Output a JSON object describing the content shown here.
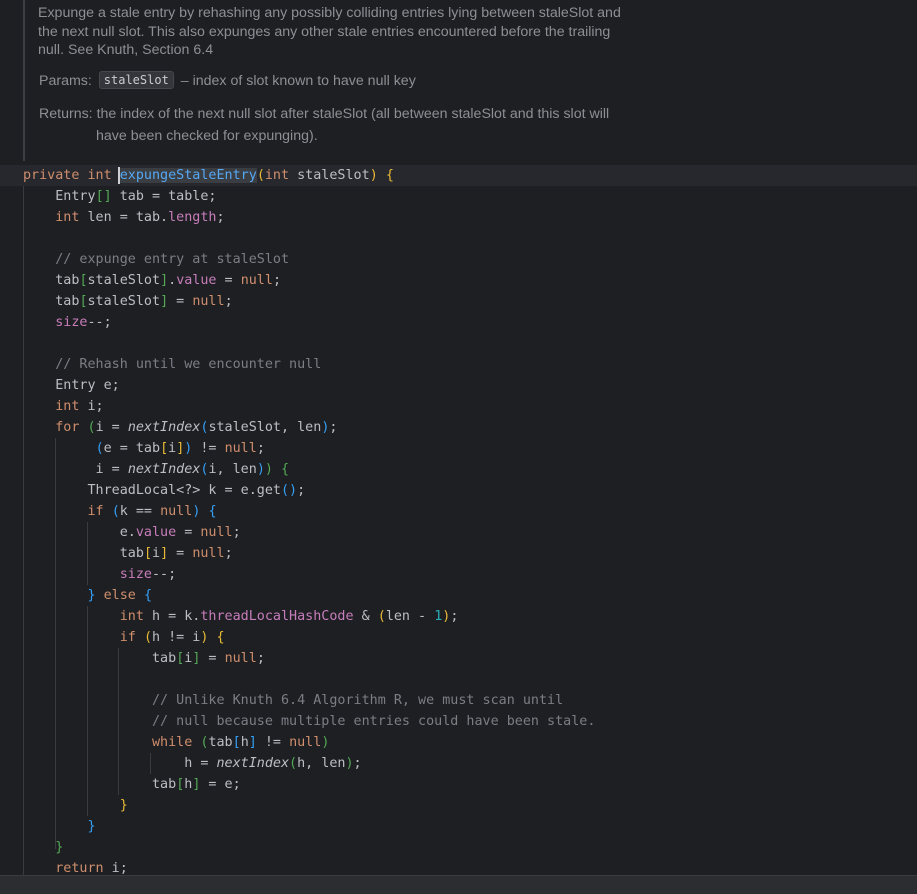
{
  "javadoc": {
    "description": "Expunge a stale entry by rehashing any possibly colliding entries lying between staleSlot and the next null slot. This also expunges any other stale entries encountered before the trailing null. See Knuth, Section 6.4",
    "params_label": "Params:",
    "param_name": "staleSlot",
    "param_desc": "– index of slot known to have null key",
    "returns_label": "Returns:",
    "returns_line1": "the index of the next null slot after staleSlot (all between staleSlot and this slot will",
    "returns_line2": "have been checked for expunging)."
  },
  "code_lines": [
    "private int expungeStaleEntry(int staleSlot) {",
    "    Entry[] tab = table;",
    "    int len = tab.length;",
    "",
    "    // expunge entry at staleSlot",
    "    tab[staleSlot].value = null;",
    "    tab[staleSlot] = null;",
    "    size--;",
    "",
    "    // Rehash until we encounter null",
    "    Entry e;",
    "    int i;",
    "    for (i = nextIndex(staleSlot, len);",
    "         (e = tab[i]) != null;",
    "         i = nextIndex(i, len)) {",
    "        ThreadLocal<?> k = e.get();",
    "        if (k == null) {",
    "            e.value = null;",
    "            tab[i] = null;",
    "            size--;",
    "        } else {",
    "            int h = k.threadLocalHashCode & (len - 1);",
    "            if (h != i) {",
    "                tab[i] = null;",
    "",
    "                // Unlike Knuth 6.4 Algorithm R, we must scan until",
    "                // null because multiple entries could have been stale.",
    "                while (tab[h] != null)",
    "                    h = nextIndex(h, len);",
    "                tab[h] = e;",
    "            }",
    "        }",
    "    }",
    "    return i;"
  ],
  "colors": {
    "background": "#1e1f22",
    "keyword": "#cf8e6d",
    "function": "#56a8f5",
    "field": "#c77dbb",
    "comment": "#7a7e85",
    "number": "#2aacb8"
  }
}
